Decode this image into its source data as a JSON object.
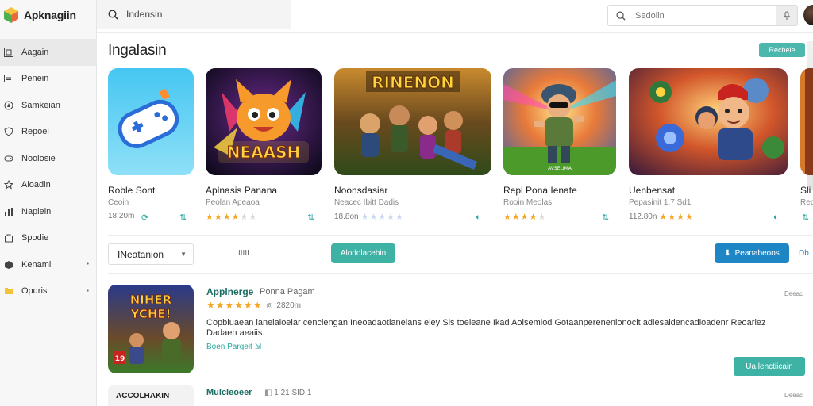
{
  "brand": {
    "name": "Apknagiin"
  },
  "sidebar": {
    "items": [
      {
        "label": "Aagain",
        "icon": "grid-icon",
        "active": true
      },
      {
        "label": "Penein",
        "icon": "list-icon"
      },
      {
        "label": "Samkeian",
        "icon": "compass-icon"
      },
      {
        "label": "Repoel",
        "icon": "shield-icon"
      },
      {
        "label": "Noolosie",
        "icon": "gamepad-icon"
      },
      {
        "label": "Aloadin",
        "icon": "star-icon"
      },
      {
        "label": "Naplein",
        "icon": "chart-icon"
      },
      {
        "label": "Spodie",
        "icon": "bag-icon"
      },
      {
        "label": "Kenami",
        "icon": "circle-icon",
        "caret": "•"
      },
      {
        "label": "Opdris",
        "icon": "folder-icon",
        "caret": "•"
      }
    ]
  },
  "topbar": {
    "search_left": "Indensin",
    "search_right": "Sedoiin"
  },
  "section": {
    "title": "Ingalasin",
    "see_all": "Recheie"
  },
  "cards": [
    {
      "name": "Roble Sont",
      "sub": "Ceoin",
      "rating_text": "18.20m",
      "stars": 0,
      "glyph": "⟳"
    },
    {
      "name": "Aplnasis Panana",
      "sub": "Peolan Apeaoa",
      "rating_text": "",
      "stars": 4,
      "glyph": "⇅"
    },
    {
      "name": "Noonsdasiar",
      "sub": "Neacec Ibitt Dadis",
      "rating_text": "18.8on",
      "stars": 5,
      "stars_style": "pale",
      "glyph": "◐"
    },
    {
      "name": "Repl Pona Ienate",
      "sub": "Rooin Meolas",
      "rating_text": "",
      "stars": 4,
      "glyph": "⇅"
    },
    {
      "name": "Uenbensat",
      "sub": "Pepasinit 1.7 Sd1",
      "rating_text": "112.80n",
      "stars": 4,
      "glyph": "◐"
    },
    {
      "name": "Sli",
      "sub": "Rep",
      "rating_text": "",
      "stars": 0,
      "glyph": "⇅"
    }
  ],
  "filters": {
    "sort_label": "INeatanion",
    "mid_label": "IIIII",
    "teal_pill": "Alodolacebin",
    "blue_pill": "Peanabeoos",
    "edge_label": "Db"
  },
  "featured": {
    "name": "Applnerge",
    "dev": "Ponna Pagam",
    "rating_text": "2820m",
    "stars": 5,
    "description": "Copbluaean laneiaioeiar cenciengan Ineoadaotlanelans eley Sis toeleane Ikad Aolsemiod Gotaanperenenlonocit adlesaidencadloadenr Reoarlez Dadaen aeaiis.",
    "link": "Boen Pargeit",
    "date": "Deeac",
    "button": "Ua lenctiicain",
    "thumb_text": "NIHER YCHE!",
    "thumb_badge": "19"
  },
  "row2": {
    "tag": "ACCOLHAKIN",
    "name": "Mulcleoeer",
    "meta": "1 21 SIDI1",
    "date": "Deeac"
  },
  "colors": {
    "teal": "#3fb2a6",
    "blue": "#1f86c6",
    "star": "#f5a623"
  }
}
